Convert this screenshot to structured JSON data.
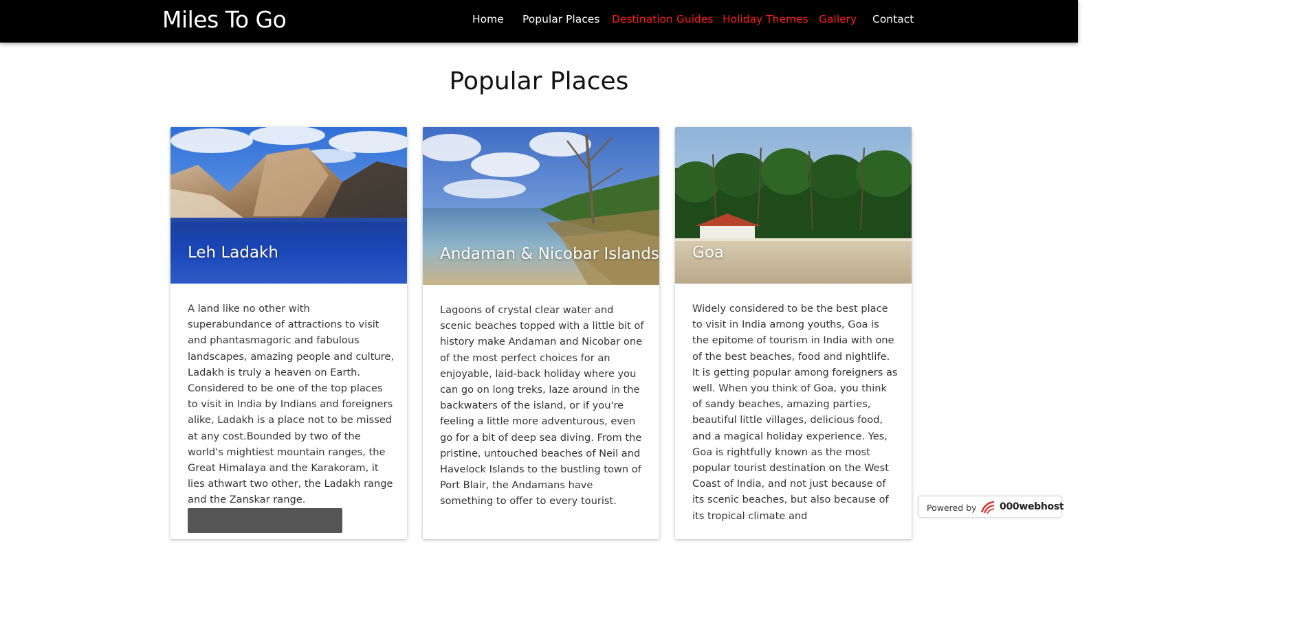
{
  "brand": "Miles To Go",
  "nav": {
    "home": "Home",
    "popular_places": "Popular Places",
    "destination_guides": "Destination Guides",
    "holiday_themes": "Holiday Themes",
    "gallery": "Gallery",
    "contact": "Contact"
  },
  "colors": {
    "navbar_bg": "#000000",
    "nav_link": "#ffffff",
    "nav_link_highlight": "#ff1a1a"
  },
  "page_title": "Popular Places",
  "cards": [
    {
      "title": "Leh Ladakh",
      "image": "mountain-lake-photo",
      "text": "A land like no other with superabundance of attractions to visit and phantasmagoric and fabulous landscapes, amazing people and culture, Ladakh is truly a heaven on Earth. Considered to be one of the top places to visit in India by Indians and foreigners alike, Ladakh is a place not to be missed at any cost.Bounded by two of the world's mightiest mountain ranges, the Great Himalaya and the Karakoram, it lies athwart two other, the Ladakh range and the Zanskar range."
    },
    {
      "title": "Andaman & Nicobar Islands",
      "image": "beach-shore-photo",
      "text": "Lagoons of crystal clear water and scenic beaches topped with a little bit of history make Andaman and Nicobar one of the most perfect choices for an enjoyable, laid-back holiday where you can go on long treks, laze around in the backwaters of the island, or if you're feeling a little more adventurous, even go for a bit of deep sea diving. From the pristine, untouched beaches of Neil and Havelock Islands to the bustling town of Port Blair, the Andamans have something to offer to every tourist."
    },
    {
      "title": "Goa",
      "image": "palm-beach-photo",
      "text": "Widely considered to be the best place to visit in India among youths, Goa is the epitome of tourism in India with one of the best beaches, food and nightlife. It is getting popular among foreigners as well. When you think of Goa, you think of sandy beaches, amazing parties, beautiful little villages, delicious food, and a magical holiday experience. Yes, Goa is rightfully known as the most popular tourist destination on the West Coast of India, and not just because of its scenic beaches, but also because of its tropical climate and"
    }
  ],
  "powered_by": {
    "label": "Powered by",
    "host": "000webhost"
  }
}
